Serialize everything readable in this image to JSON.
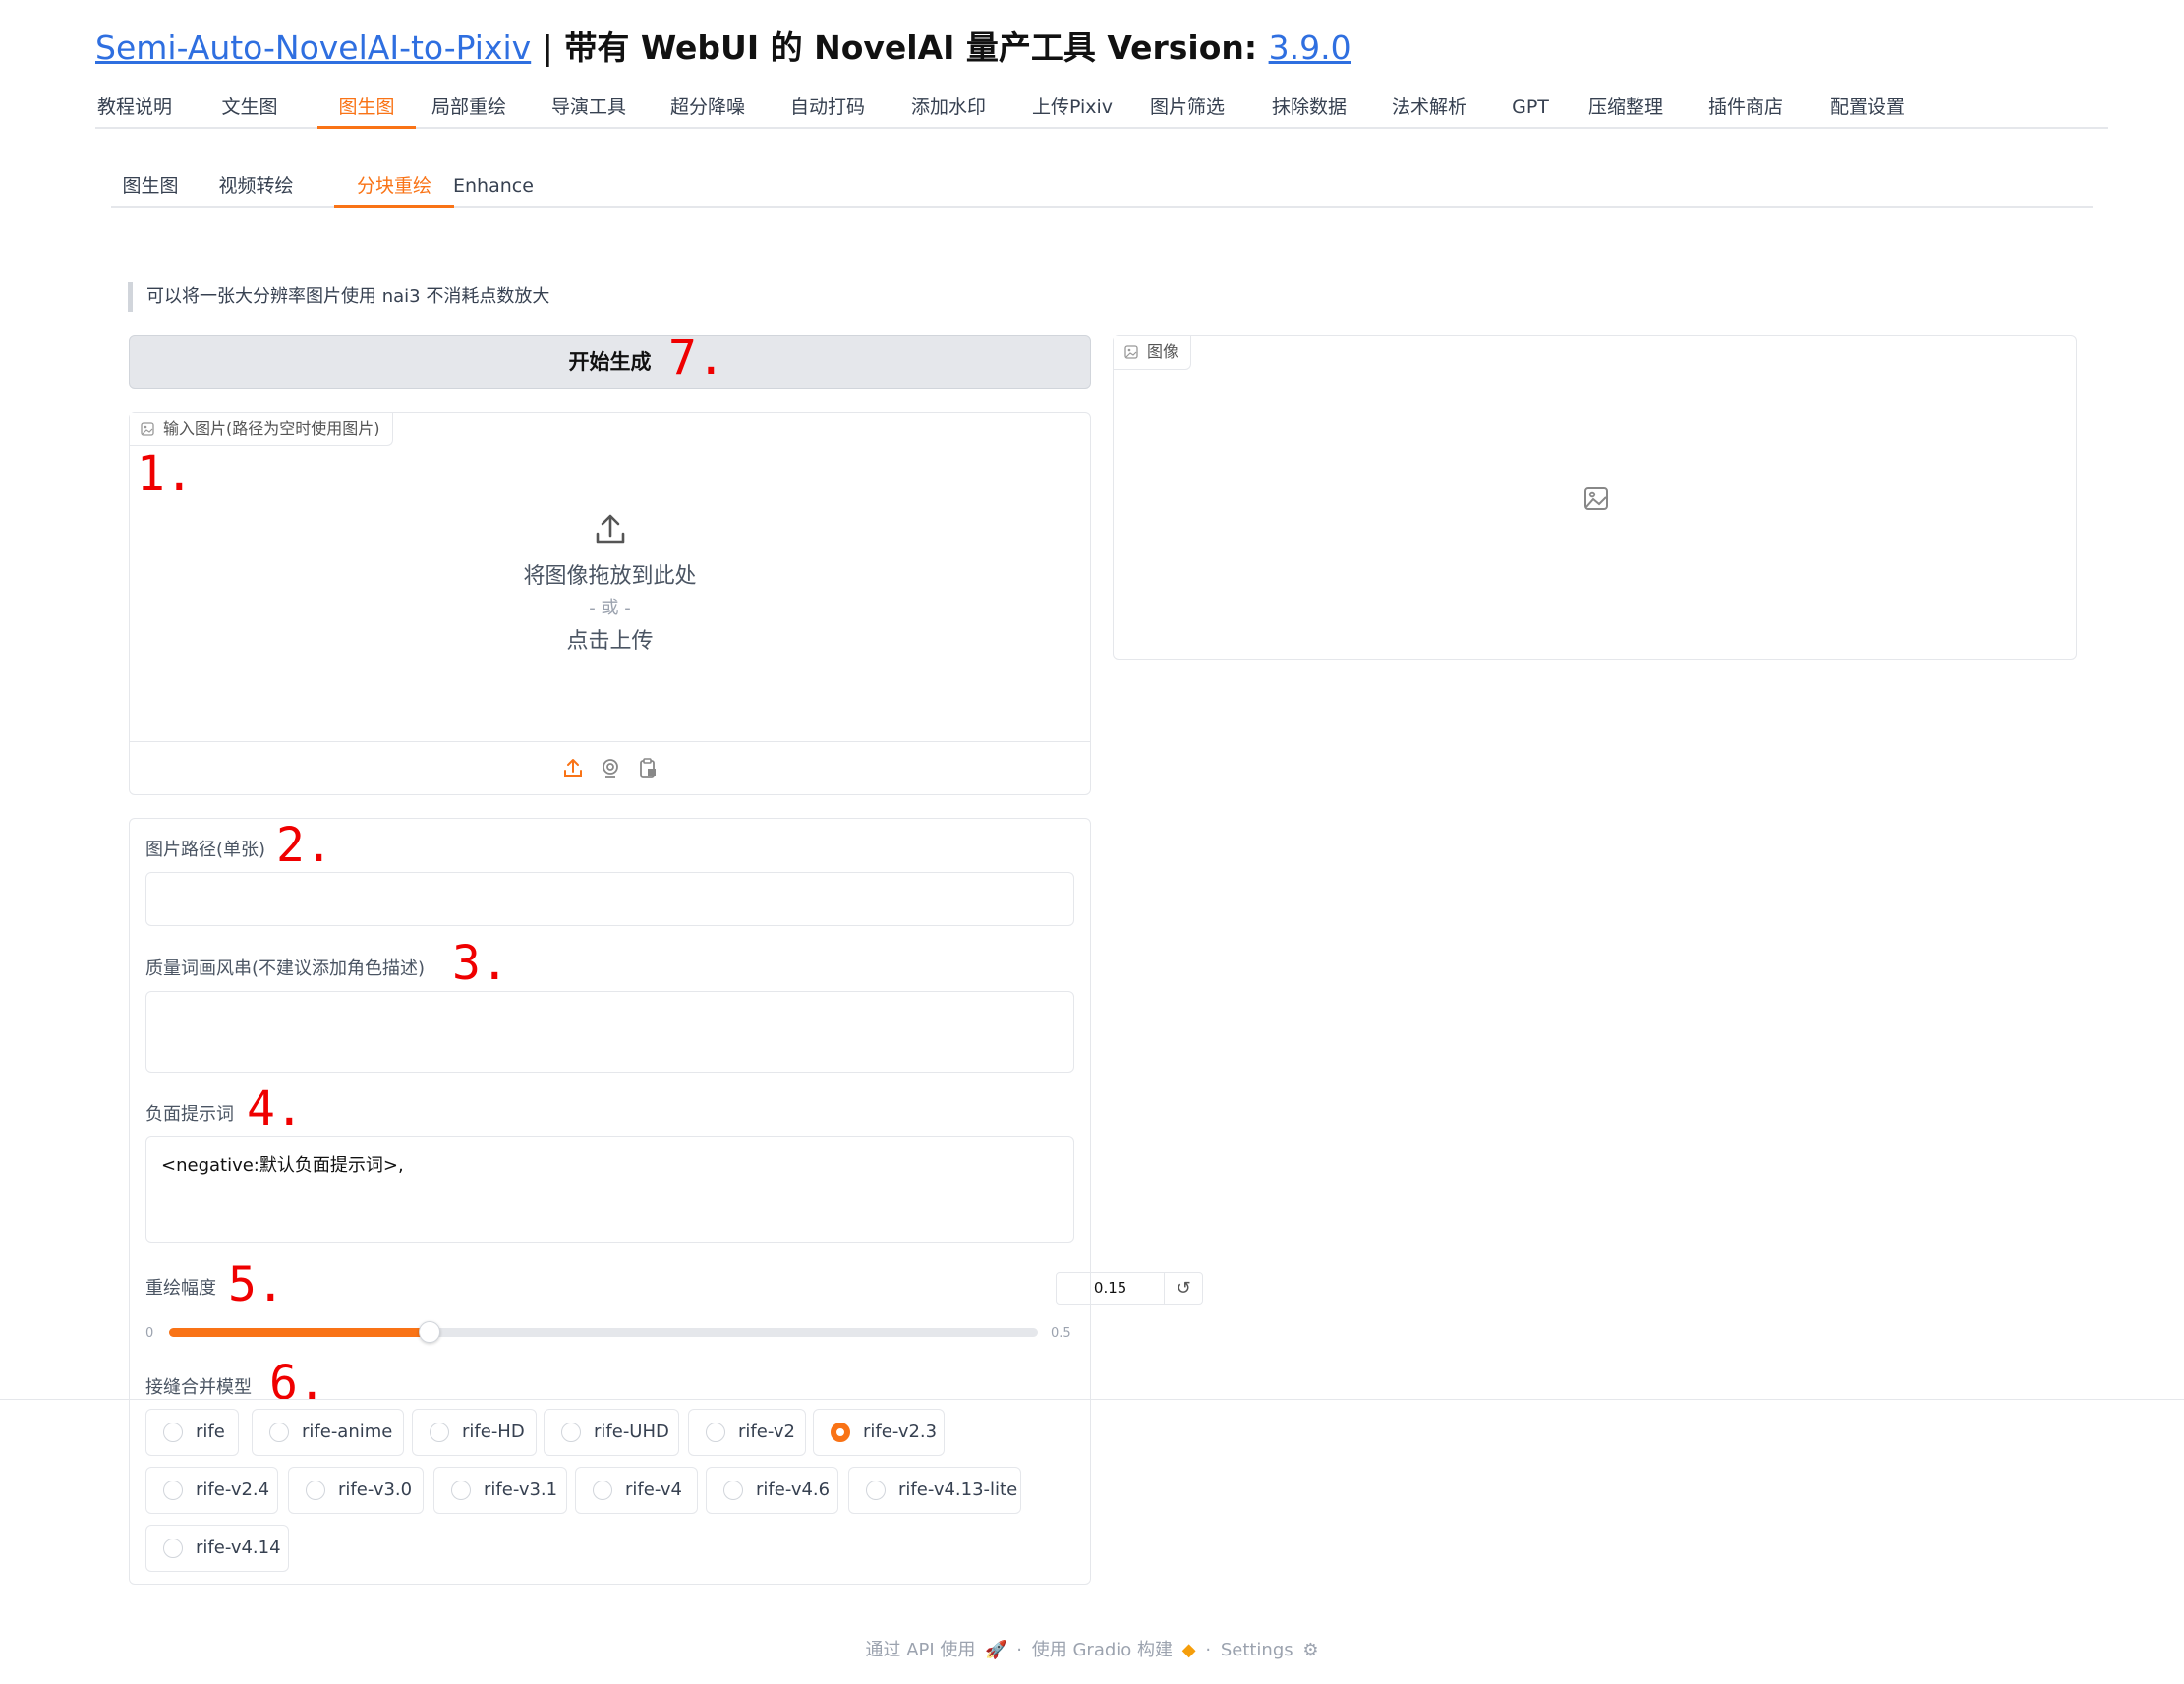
{
  "header": {
    "repo_link": "Semi-Auto-NovelAI-to-Pixiv",
    "separator": "|",
    "title_text": "带有 WebUI 的 NovelAI 量产工具 Version:",
    "version_link": "3.9.0"
  },
  "main_tabs": [
    {
      "label": "教程说明"
    },
    {
      "label": "文生图"
    },
    {
      "label": "图生图",
      "active": true
    },
    {
      "label": "局部重绘"
    },
    {
      "label": "导演工具"
    },
    {
      "label": "超分降噪"
    },
    {
      "label": "自动打码"
    },
    {
      "label": "添加水印"
    },
    {
      "label": "上传Pixiv"
    },
    {
      "label": "图片筛选"
    },
    {
      "label": "抹除数据"
    },
    {
      "label": "法术解析"
    },
    {
      "label": "GPT"
    },
    {
      "label": "压缩整理"
    },
    {
      "label": "插件商店"
    },
    {
      "label": "配置设置"
    }
  ],
  "sub_tabs": [
    {
      "label": "图生图"
    },
    {
      "label": "视频转绘"
    },
    {
      "label": "分块重绘",
      "active": true
    },
    {
      "label": "Enhance"
    }
  ],
  "description": "可以将一张大分辨率图片使用 nai3 不消耗点数放大",
  "generate_button": "开始生成",
  "annotations": {
    "a1": "1.",
    "a2": "2.",
    "a3": "3.",
    "a4": "4.",
    "a5": "5.",
    "a6": "6.",
    "a7": "7."
  },
  "input_image": {
    "label": "输入图片(路径为空时使用图片)",
    "drop_text": "将图像拖放到此处",
    "or_text": "- 或 -",
    "click_text": "点击上传",
    "icons": [
      "upload-icon",
      "webcam-icon",
      "clipboard-icon"
    ]
  },
  "output_image": {
    "label": "图像",
    "icon": "image-placeholder-icon"
  },
  "form": {
    "image_path_label": "图片路径(单张)",
    "image_path_value": "",
    "quality_label": "质量词画风串(不建议添加角色描述)",
    "quality_value": "",
    "negative_label": "负面提示词",
    "negative_value": "<negative:默认负面提示词>,",
    "strength_label": "重绘幅度",
    "strength_value": "0.15",
    "strength_min": "0",
    "strength_max": "0.5",
    "strength_fraction": 0.3,
    "model_label": "接缝合并模型",
    "models": [
      {
        "label": "rife"
      },
      {
        "label": "rife-anime"
      },
      {
        "label": "rife-HD"
      },
      {
        "label": "rife-UHD"
      },
      {
        "label": "rife-v2"
      },
      {
        "label": "rife-v2.3",
        "checked": true
      },
      {
        "label": "rife-v2.4"
      },
      {
        "label": "rife-v3.0"
      },
      {
        "label": "rife-v3.1"
      },
      {
        "label": "rife-v4"
      },
      {
        "label": "rife-v4.6"
      },
      {
        "label": "rife-v4.13-lite"
      },
      {
        "label": "rife-v4.14"
      }
    ]
  },
  "footer": {
    "api": "通过 API 使用",
    "dot": "·",
    "gradio": "使用 Gradio 构建",
    "settings": "Settings"
  },
  "colors": {
    "accent": "#f97316",
    "annotation": "#ef0000",
    "link": "#2f6fe0"
  }
}
